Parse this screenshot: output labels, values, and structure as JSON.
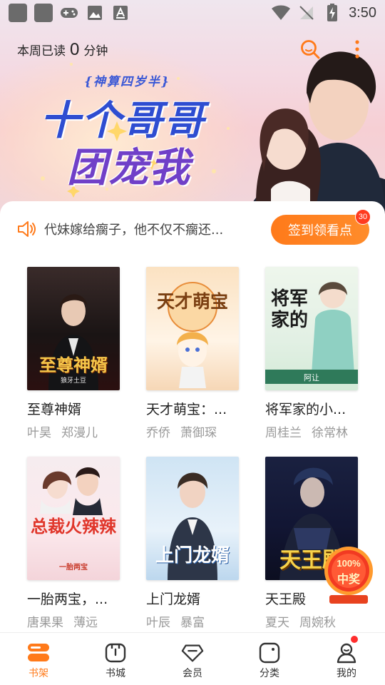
{
  "status_bar": {
    "time": "3:50",
    "icons": [
      "app-icon",
      "app-icon",
      "gamepad-icon",
      "image-icon",
      "font-icon",
      "wifi-icon",
      "no-signal-icon",
      "battery-charging-icon"
    ]
  },
  "header": {
    "read_prefix": "本周已读",
    "read_minutes": "0",
    "read_unit": "分钟",
    "icons": [
      "search-icon",
      "more-vertical-icon"
    ]
  },
  "banner": {
    "subtitle": "{神算四岁半}",
    "title_line1": "十个哥哥",
    "title_line2": "团宠我"
  },
  "notice": {
    "text": "代妹嫁给瘸子，他不仅不瘸还...",
    "checkin_label": "签到领看点",
    "checkin_badge": "30"
  },
  "books": [
    {
      "title": "至尊神婿",
      "authors": [
        "叶昊",
        "郑漫儿"
      ],
      "cover_text": "至尊神婿",
      "cover_sub": "狼牙土豆"
    },
    {
      "title": "天才萌宝：...",
      "authors": [
        "乔侨",
        "萧御琛"
      ],
      "cover_text": "天才萌宝",
      "cover_sub": ""
    },
    {
      "title": "将军家的小...",
      "authors": [
        "周桂兰",
        "徐常林"
      ],
      "cover_text": "将军家的",
      "cover_sub": "阿让"
    },
    {
      "title": "一胎两宝，...",
      "authors": [
        "唐果果",
        "薄远"
      ],
      "cover_text": "总裁火辣辣",
      "cover_sub": "一胎两宝"
    },
    {
      "title": "上门龙婿",
      "authors": [
        "叶辰",
        "暴富"
      ],
      "cover_text": "上门龙婿",
      "cover_sub": ""
    },
    {
      "title": "天王殿",
      "authors": [
        "夏天",
        "周婉秋"
      ],
      "cover_text": "天王殿",
      "cover_sub": ""
    }
  ],
  "promo": {
    "line1": "100%",
    "line2": "中奖"
  },
  "bottom_nav": [
    {
      "label": "书架",
      "active": true
    },
    {
      "label": "书城",
      "active": false
    },
    {
      "label": "会员",
      "active": false
    },
    {
      "label": "分类",
      "active": false
    },
    {
      "label": "我的",
      "active": false
    }
  ],
  "colors": {
    "accent": "#ff7a1a",
    "badge": "#ff3b1f",
    "banner_blue": "#2e4dd1",
    "banner_purple": "#7040c8"
  }
}
